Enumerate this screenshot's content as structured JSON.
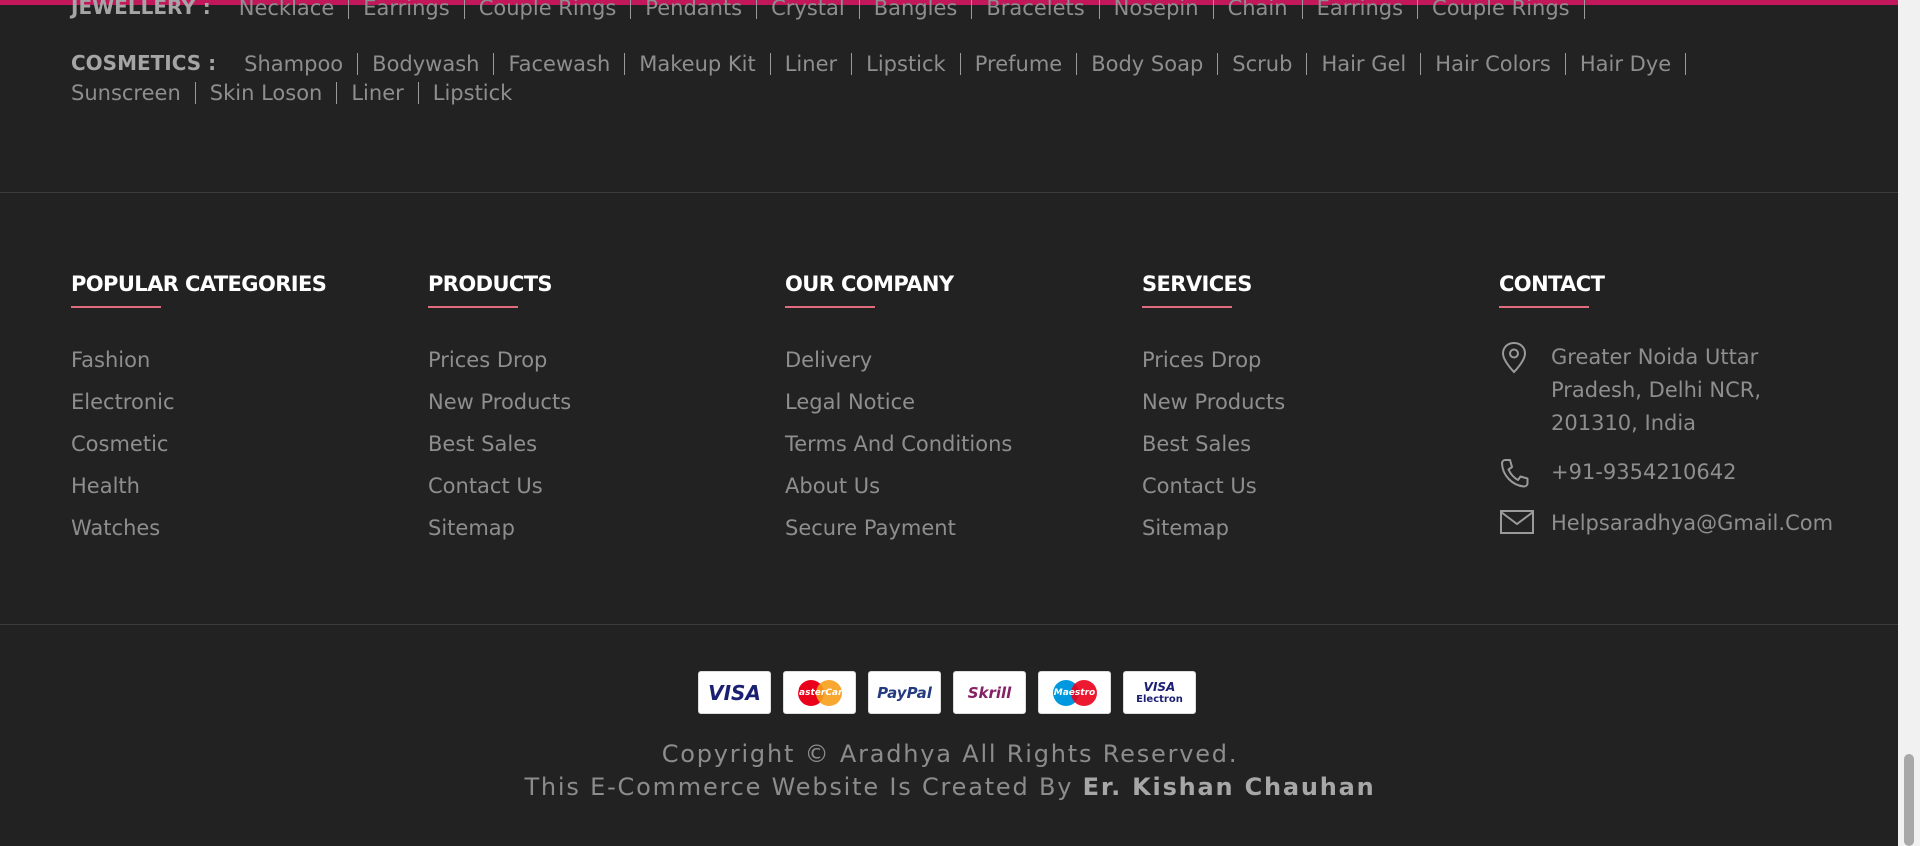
{
  "tags": {
    "jewellery": {
      "heading": "JEWELLERY :",
      "items": [
        "Necklace",
        "Earrings",
        "Couple Rings",
        "Pendants",
        "Crystal",
        "Bangles",
        "Bracelets",
        "Nosepin",
        "Chain",
        "Earrings",
        "Couple Rings"
      ]
    },
    "cosmetics": {
      "heading": "COSMETICS :",
      "items": [
        "Shampoo",
        "Bodywash",
        "Facewash",
        "Makeup Kit",
        "Liner",
        "Lipstick",
        "Prefume",
        "Body Soap",
        "Scrub",
        "Hair Gel",
        "Hair Colors",
        "Hair Dye",
        "Sunscreen",
        "Skin Loson",
        "Liner",
        "Lipstick"
      ]
    }
  },
  "footer": {
    "popular_categories": {
      "title": "POPULAR CATEGORIES",
      "items": [
        "Fashion",
        "Electronic",
        "Cosmetic",
        "Health",
        "Watches"
      ]
    },
    "products": {
      "title": "PRODUCTS",
      "items": [
        "Prices Drop",
        "New Products",
        "Best Sales",
        "Contact Us",
        "Sitemap"
      ]
    },
    "our_company": {
      "title": "OUR COMPANY",
      "items": [
        "Delivery",
        "Legal Notice",
        "Terms And Conditions",
        "About Us",
        "Secure Payment"
      ]
    },
    "services": {
      "title": "SERVICES",
      "items": [
        "Prices Drop",
        "New Products",
        "Best Sales",
        "Contact Us",
        "Sitemap"
      ]
    },
    "contact": {
      "title": "CONTACT",
      "address_lines": [
        "Greater Noida Uttar",
        "Pradesh, Delhi NCR,",
        "201310, India"
      ],
      "phone": "+91-9354210642",
      "email": "Helpsaradhya@Gmail.Com",
      "icons": [
        "location-pin-icon",
        "phone-icon",
        "mail-icon"
      ]
    }
  },
  "payments": [
    {
      "name": "visa",
      "label": "VISA",
      "color": "#1a1f71"
    },
    {
      "name": "mastercard",
      "label": "MasterCard",
      "color": "#eb001b"
    },
    {
      "name": "paypal",
      "label": "PayPal",
      "color": "#253b80"
    },
    {
      "name": "skrill",
      "label": "Skrill",
      "color": "#862165"
    },
    {
      "name": "maestro",
      "label": "Maestro",
      "color": "#0099df"
    },
    {
      "name": "visa-electron",
      "label": "VISA",
      "sub": "Electron",
      "color": "#1a1f71"
    }
  ],
  "copyright": {
    "line1": "Copyright © Aradhya All Rights Reserved.",
    "line2_prefix": "This E-Commerce Website Is Created By",
    "author": "Er. Kishan Chauhan"
  },
  "colors": {
    "background": "#222222",
    "accent": "#c2185b",
    "heading_underline": "#e06b7c"
  }
}
